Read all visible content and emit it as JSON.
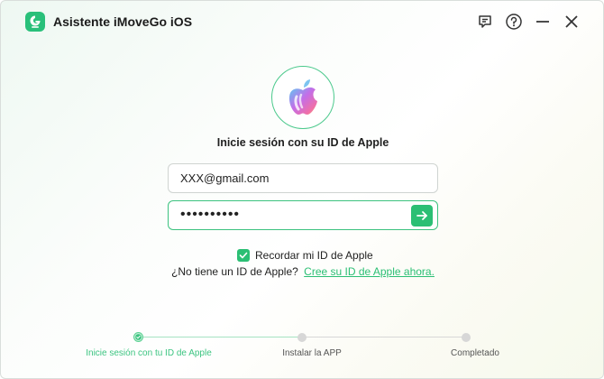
{
  "app": {
    "title": "Asistente iMoveGo iOS",
    "accent_color": "#2bbf74",
    "logo_icon": "imovego-logo-icon"
  },
  "titlebar": {
    "icons": [
      "feedback-icon",
      "help-icon",
      "minimize-icon",
      "close-icon"
    ]
  },
  "login": {
    "avatar_icon": "apple-logo-icon",
    "heading": "Inicie sesión con su ID de Apple",
    "email_value": "XXX@gmail.com",
    "password_value": "••••••••••",
    "submit_icon": "arrow-right-icon",
    "remember_label": "Recordar mi ID de Apple",
    "remember_checked": true,
    "no_id_text": "¿No tiene un ID de Apple?",
    "create_link": "Cree su ID de Apple ahora."
  },
  "steps": [
    {
      "label": "Inicie sesión con tu ID de Apple",
      "status": "active"
    },
    {
      "label": "Instalar la APP",
      "status": "pending"
    },
    {
      "label": "Completado",
      "status": "pending"
    }
  ]
}
